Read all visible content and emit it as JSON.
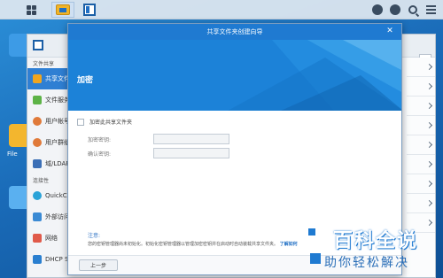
{
  "taskbar": {
    "icons": [
      "main-menu-icon",
      "file-station-icon",
      "control-panel-icon",
      "notification-icon",
      "user-icon",
      "search-icon",
      "options-icon"
    ]
  },
  "desktop": {
    "file_label": "File"
  },
  "control_panel": {
    "sidebar": {
      "category_file_sharing": "文件共享",
      "items": [
        {
          "label": "共享文件夹",
          "icon": "shared-folder-icon",
          "color": "#f0a520",
          "active": true
        },
        {
          "label": "文件服务",
          "icon": "file-services-icon",
          "color": "#5db347"
        },
        {
          "label": "用户帐号",
          "icon": "user-icon",
          "color": "#e07a3a"
        },
        {
          "label": "用户群组",
          "icon": "group-icon",
          "color": "#e07a3a"
        },
        {
          "label": "域/LDAP",
          "icon": "domain-icon",
          "color": "#3b6fb6"
        }
      ],
      "category_connectivity": "连接性",
      "items2": [
        {
          "label": "QuickConnect",
          "icon": "quickconnect-icon",
          "color": "#2aa3d8"
        },
        {
          "label": "外部访问",
          "icon": "external-access-icon",
          "color": "#3a8ad4"
        },
        {
          "label": "网络",
          "icon": "network-icon",
          "color": "#e05a4a"
        },
        {
          "label": "DHCP Server",
          "icon": "dhcp-icon",
          "color": "#2a7fd0"
        }
      ]
    }
  },
  "wizard": {
    "title": "共享文件夹创建向导",
    "heading": "加密",
    "encrypt_checkbox_label": "加密此共享文件夹",
    "checkbox_checked": false,
    "fields": [
      {
        "label": "加密密钥:",
        "value": ""
      },
      {
        "label": "确认密钥:",
        "value": ""
      }
    ],
    "note_title": "注意:",
    "note_text": "您的密钥管理器尚未初始化。初始化密钥管理器以管理加密密钥并在启动时自动装载共享文件夹。",
    "note_link": "了解如何",
    "prev_button": "上一步",
    "header_color": "#1c82d8"
  },
  "watermark": {
    "title": "百科全说",
    "subtitle": "助你轻松解决"
  }
}
